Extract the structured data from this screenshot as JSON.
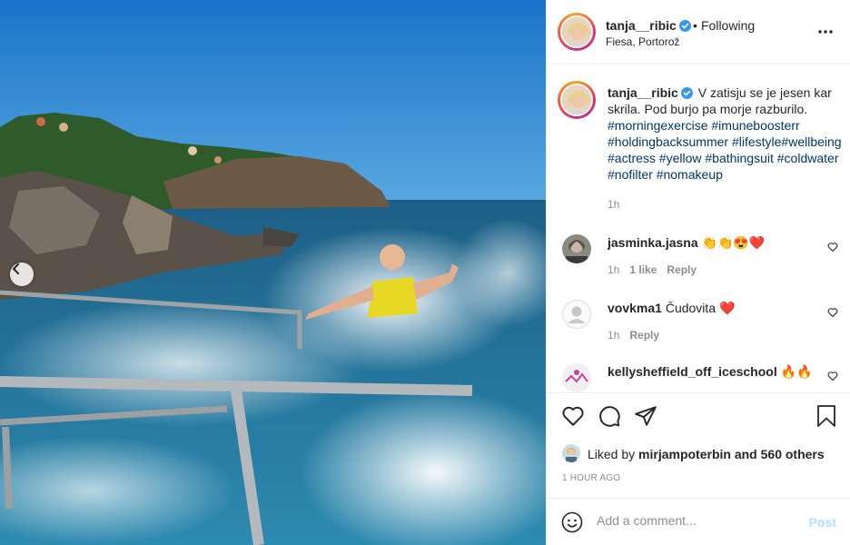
{
  "post": {
    "username": "tanja__ribic",
    "verified": true,
    "separator": "•",
    "follow_status": "Following",
    "location": "Fiesa, Portorož",
    "caption_text": "V zatisju se je jesen kar skrila. Pod burjo pa morje razburilo.",
    "hashtags": "#morningexercise #imuneboosterr #holdingbacksummer #lifestyle#wellbeing #actress #yellow #bathingsuit #coldwater #nofilter #nomakeup",
    "caption_time": "1h"
  },
  "comments": [
    {
      "username": "jasminka.jasna",
      "text": "👏👏😍❤️",
      "time": "1h",
      "likes": "1 like",
      "reply": "Reply"
    },
    {
      "username": "vovkma1",
      "text": "Čudovita ❤️",
      "time": "1h",
      "reply": "Reply"
    },
    {
      "username": "kellysheffield_off_iceschool",
      "text": "🔥🔥"
    }
  ],
  "likes": {
    "prefix": "Liked by",
    "user": "mirjampoterbin",
    "suffix": "and 560 others"
  },
  "time_ago": "1 HOUR AGO",
  "add_comment": {
    "placeholder": "Add a comment...",
    "post_label": "Post"
  },
  "colors": {
    "link": "#00376b",
    "verified": "#3897f0",
    "muted": "#8e8e8e",
    "post_disabled": "#b2dffc"
  },
  "icons": [
    "chevron-left-icon",
    "more-icon",
    "verified-icon",
    "heart-icon",
    "comment-icon",
    "share-icon",
    "bookmark-icon",
    "emoji-icon"
  ]
}
